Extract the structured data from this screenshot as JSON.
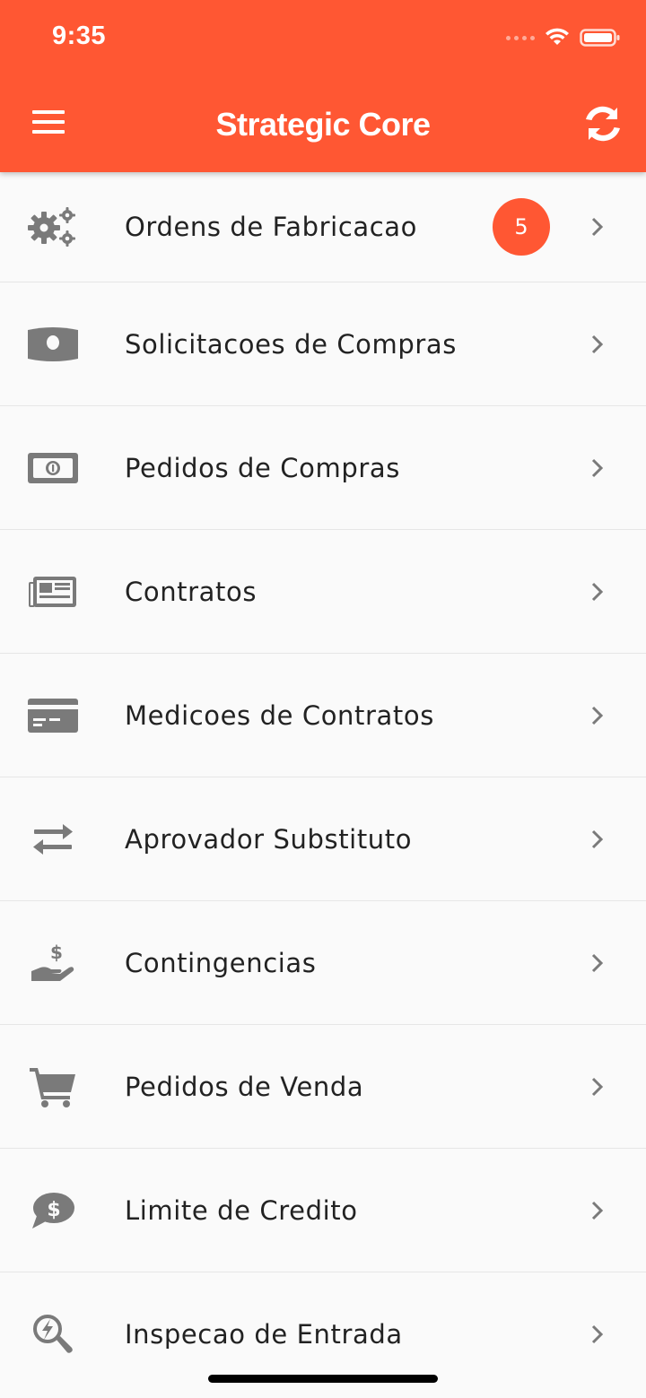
{
  "status_bar": {
    "time": "9:35",
    "signal_icon": "signal-dots-icon",
    "wifi_icon": "wifi-icon",
    "battery_icon": "battery-icon"
  },
  "app_bar": {
    "title": "Strategic Core",
    "menu_icon": "hamburger-menu-icon",
    "refresh_icon": "sync-refresh-icon",
    "background_color": "#ff5733"
  },
  "menu": {
    "items": [
      {
        "label": "Ordens de Fabricacao",
        "icon": "gears-icon",
        "badge": "5"
      },
      {
        "label": "Solicitacoes de Compras",
        "icon": "money-bill-icon"
      },
      {
        "label": "Pedidos de Compras",
        "icon": "money-bill-outline-icon"
      },
      {
        "label": "Contratos",
        "icon": "newspaper-icon"
      },
      {
        "label": "Medicoes de Contratos",
        "icon": "credit-card-icon"
      },
      {
        "label": "Aprovador Substituto",
        "icon": "exchange-arrows-icon"
      },
      {
        "label": "Contingencias",
        "icon": "hand-holding-dollar-icon"
      },
      {
        "label": "Pedidos de Venda",
        "icon": "shopping-cart-icon"
      },
      {
        "label": "Limite de Credito",
        "icon": "comment-dollar-icon"
      },
      {
        "label": "Inspecao de Entrada",
        "icon": "search-bolt-icon"
      }
    ]
  },
  "colors": {
    "accent": "#ff5733",
    "icon_gray": "#7a7a7a",
    "text": "#222222"
  }
}
